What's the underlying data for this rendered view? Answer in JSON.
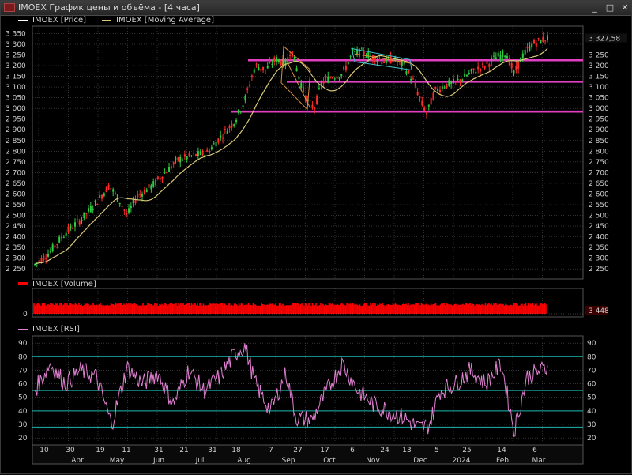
{
  "window": {
    "title": "IMOEX График цены и объёма - [4 часа]",
    "controls": {
      "minimize": "_",
      "maximize": "□",
      "close": "✕"
    }
  },
  "colors": {
    "price_up": "#2ecc40",
    "price_down": "#ff2a2a",
    "moving_average": "#d8c878",
    "support_resistance": "#e040c0",
    "volume": "#ff0000",
    "rsi": "#e080d0",
    "rsi_levels": "#18b8b0",
    "trend_channel": "#d89040",
    "trend_channel_2": "#40c0d0",
    "grid": "#505050"
  },
  "price_panel": {
    "legend": [
      {
        "label": "IMOEX [Price]",
        "color": "#ffffff"
      },
      {
        "label": "IMOEX [Moving Average]",
        "color": "#d8c878"
      }
    ],
    "y_ticks": [
      "3 350",
      "3 300",
      "3 250",
      "3 200",
      "3 150",
      "3 100",
      "3 050",
      "3 000",
      "2 950",
      "2 900",
      "2 850",
      "2 800",
      "2 750",
      "2 700",
      "2 650",
      "2 600",
      "2 550",
      "2 500",
      "2 450",
      "2 400",
      "2 350",
      "2 300",
      "2 250"
    ],
    "y_ticks_right": [
      "3 250",
      "3 200",
      "3 150",
      "3 100",
      "3 050",
      "3 000",
      "2 950",
      "2 900",
      "2 850",
      "2 800",
      "2 750",
      "2 700",
      "2 650",
      "2 600",
      "2 550",
      "2 500",
      "2 450",
      "2 400",
      "2 350",
      "2 300",
      "2 250"
    ],
    "last_price": "3 327,58",
    "ylim": [
      2225,
      3370
    ],
    "horizontal_levels": [
      3225,
      3125,
      2985
    ]
  },
  "volume_panel": {
    "legend": [
      {
        "label": "IMOEX [Volume]",
        "color": "#ff0000"
      }
    ],
    "zero_label": "0",
    "last_value": "3 448"
  },
  "rsi_panel": {
    "legend": [
      {
        "label": "IMOEX [RSI]",
        "color": "#e080d0"
      }
    ],
    "y_ticks": [
      "90",
      "80",
      "70",
      "60",
      "50",
      "40",
      "30",
      "20"
    ],
    "levels": [
      80,
      55,
      40,
      28
    ],
    "ylim": [
      16,
      93
    ]
  },
  "x_axis": {
    "day_labels": [
      "10",
      "30",
      "19",
      "11",
      "31",
      "21",
      "31",
      "18",
      "7",
      "27",
      "17",
      "6",
      "24",
      "13",
      "5",
      "25",
      "14",
      "6"
    ],
    "month_labels": [
      "Apr",
      "May",
      "Jun",
      "Jul",
      "Aug",
      "Sep",
      "Oct",
      "Nov",
      "Dec",
      "2024",
      "Feb",
      "Mar"
    ]
  },
  "chart_data": {
    "type": "line",
    "price_anchors": [
      {
        "t": 0.0,
        "v": 2270
      },
      {
        "t": 0.03,
        "v": 2330
      },
      {
        "t": 0.06,
        "v": 2420
      },
      {
        "t": 0.09,
        "v": 2480
      },
      {
        "t": 0.12,
        "v": 2560
      },
      {
        "t": 0.145,
        "v": 2640
      },
      {
        "t": 0.165,
        "v": 2570
      },
      {
        "t": 0.18,
        "v": 2500
      },
      {
        "t": 0.2,
        "v": 2590
      },
      {
        "t": 0.23,
        "v": 2640
      },
      {
        "t": 0.25,
        "v": 2690
      },
      {
        "t": 0.28,
        "v": 2760
      },
      {
        "t": 0.31,
        "v": 2780
      },
      {
        "t": 0.335,
        "v": 2790
      },
      {
        "t": 0.36,
        "v": 2860
      },
      {
        "t": 0.39,
        "v": 2940
      },
      {
        "t": 0.41,
        "v": 3040
      },
      {
        "t": 0.43,
        "v": 3200
      },
      {
        "t": 0.45,
        "v": 3180
      },
      {
        "t": 0.47,
        "v": 3230
      },
      {
        "t": 0.49,
        "v": 3210
      },
      {
        "t": 0.5,
        "v": 3280
      },
      {
        "t": 0.515,
        "v": 3150
      },
      {
        "t": 0.53,
        "v": 3040
      },
      {
        "t": 0.545,
        "v": 3000
      },
      {
        "t": 0.56,
        "v": 3120
      },
      {
        "t": 0.58,
        "v": 3150
      },
      {
        "t": 0.6,
        "v": 3160
      },
      {
        "t": 0.62,
        "v": 3260
      },
      {
        "t": 0.64,
        "v": 3260
      },
      {
        "t": 0.66,
        "v": 3240
      },
      {
        "t": 0.68,
        "v": 3220
      },
      {
        "t": 0.7,
        "v": 3230
      },
      {
        "t": 0.72,
        "v": 3200
      },
      {
        "t": 0.74,
        "v": 3120
      },
      {
        "t": 0.755,
        "v": 3020
      },
      {
        "t": 0.765,
        "v": 2975
      },
      {
        "t": 0.78,
        "v": 3080
      },
      {
        "t": 0.8,
        "v": 3110
      },
      {
        "t": 0.82,
        "v": 3120
      },
      {
        "t": 0.84,
        "v": 3150
      },
      {
        "t": 0.86,
        "v": 3180
      },
      {
        "t": 0.88,
        "v": 3200
      },
      {
        "t": 0.9,
        "v": 3240
      },
      {
        "t": 0.92,
        "v": 3260
      },
      {
        "t": 0.935,
        "v": 3160
      },
      {
        "t": 0.95,
        "v": 3240
      },
      {
        "t": 0.97,
        "v": 3300
      },
      {
        "t": 1.0,
        "v": 3330
      }
    ],
    "rsi_anchors": [
      {
        "t": 0.0,
        "v": 55
      },
      {
        "t": 0.03,
        "v": 75
      },
      {
        "t": 0.06,
        "v": 60
      },
      {
        "t": 0.09,
        "v": 70
      },
      {
        "t": 0.12,
        "v": 65
      },
      {
        "t": 0.15,
        "v": 30
      },
      {
        "t": 0.18,
        "v": 72
      },
      {
        "t": 0.21,
        "v": 60
      },
      {
        "t": 0.24,
        "v": 68
      },
      {
        "t": 0.27,
        "v": 45
      },
      {
        "t": 0.3,
        "v": 70
      },
      {
        "t": 0.33,
        "v": 55
      },
      {
        "t": 0.36,
        "v": 65
      },
      {
        "t": 0.39,
        "v": 82
      },
      {
        "t": 0.41,
        "v": 88
      },
      {
        "t": 0.43,
        "v": 60
      },
      {
        "t": 0.46,
        "v": 40
      },
      {
        "t": 0.49,
        "v": 68
      },
      {
        "t": 0.51,
        "v": 35
      },
      {
        "t": 0.54,
        "v": 33
      },
      {
        "t": 0.57,
        "v": 55
      },
      {
        "t": 0.6,
        "v": 75
      },
      {
        "t": 0.63,
        "v": 55
      },
      {
        "t": 0.66,
        "v": 45
      },
      {
        "t": 0.69,
        "v": 40
      },
      {
        "t": 0.72,
        "v": 35
      },
      {
        "t": 0.75,
        "v": 27
      },
      {
        "t": 0.77,
        "v": 30
      },
      {
        "t": 0.79,
        "v": 55
      },
      {
        "t": 0.82,
        "v": 60
      },
      {
        "t": 0.85,
        "v": 70
      },
      {
        "t": 0.88,
        "v": 60
      },
      {
        "t": 0.91,
        "v": 75
      },
      {
        "t": 0.935,
        "v": 25
      },
      {
        "t": 0.96,
        "v": 65
      },
      {
        "t": 1.0,
        "v": 72
      }
    ]
  }
}
